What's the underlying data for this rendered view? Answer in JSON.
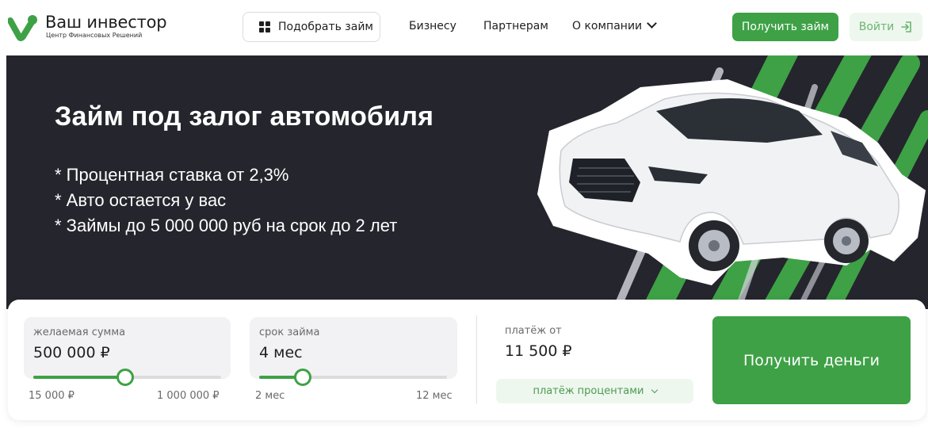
{
  "brand": {
    "name": "Ваш инвестор",
    "tagline": "Центр Финансовых Решений",
    "accent": "#3ea146",
    "hero_bg": "#25252d"
  },
  "header": {
    "pick_loan": {
      "label": "Подобрать займ",
      "icon": "grid-icon"
    },
    "nav": [
      {
        "label": "Бизнесу"
      },
      {
        "label": "Партнерам"
      },
      {
        "label": "О компании",
        "icon": "chevron-down-icon"
      }
    ],
    "get_loan": "Получить займ",
    "login": {
      "label": "Войти",
      "icon": "login-icon"
    }
  },
  "hero": {
    "title": "Займ под залог автомобиля",
    "bullets": [
      "* Процентная ставка от 2,3%",
      "* Авто остается у вас",
      "* Займы до 5 000 000 руб на срок до 2 лет"
    ]
  },
  "calculator": {
    "amount": {
      "label": "желаемая сумма",
      "value": "500 000 ₽",
      "min": "15 000 ₽",
      "max": "1 000 000 ₽",
      "fill_fraction": 0.49
    },
    "term": {
      "label": "срок займа",
      "value": "4 мес",
      "min": "2 мес",
      "max": "12 мес",
      "fill_fraction": 0.23
    },
    "payment": {
      "label": "платёж от",
      "value": "11 500 ₽",
      "mode": "платёж процентами"
    },
    "submit": "Получить деньги"
  }
}
